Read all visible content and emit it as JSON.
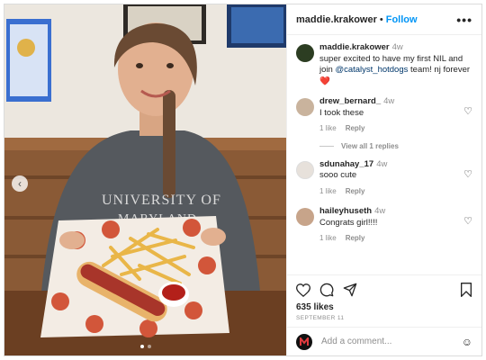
{
  "post": {
    "username": "maddie.krakower",
    "follow_label": "Follow",
    "more_glyph": "•••",
    "photo_prev_glyph": "‹"
  },
  "caption": {
    "username": "maddie.krakower",
    "time": "4w",
    "text_before": "super excited to have my first NIL and join ",
    "mention": "@catalyst_hotdogs",
    "text_after": " team! nj forever",
    "emoji": "❤️"
  },
  "comments": [
    {
      "username": "drew_bernard_",
      "time": "4w",
      "text": "I took these",
      "likes": "1 like",
      "reply": "Reply",
      "view_replies": "View all 1 replies"
    },
    {
      "username": "sdunahay_17",
      "time": "4w",
      "text": "sooo cute",
      "likes": "1 like",
      "reply": "Reply"
    },
    {
      "username": "haileyhuseth",
      "time": "4w",
      "text": "Congrats girl!!!!",
      "likes": "1 like",
      "reply": "Reply"
    }
  ],
  "stats": {
    "likes": "635 likes",
    "date": "SEPTEMBER 11"
  },
  "add_comment": {
    "placeholder": "Add a comment...",
    "emoji_glyph": "☺"
  },
  "colors": {
    "link": "#0095f6",
    "mention": "#00376b",
    "heart": "#ed4956",
    "muted": "#8e8e8e"
  },
  "icons": [
    "more-icon",
    "heart-icon",
    "comment-icon",
    "share-icon",
    "bookmark-icon",
    "emoji-icon",
    "chevron-left-icon"
  ]
}
